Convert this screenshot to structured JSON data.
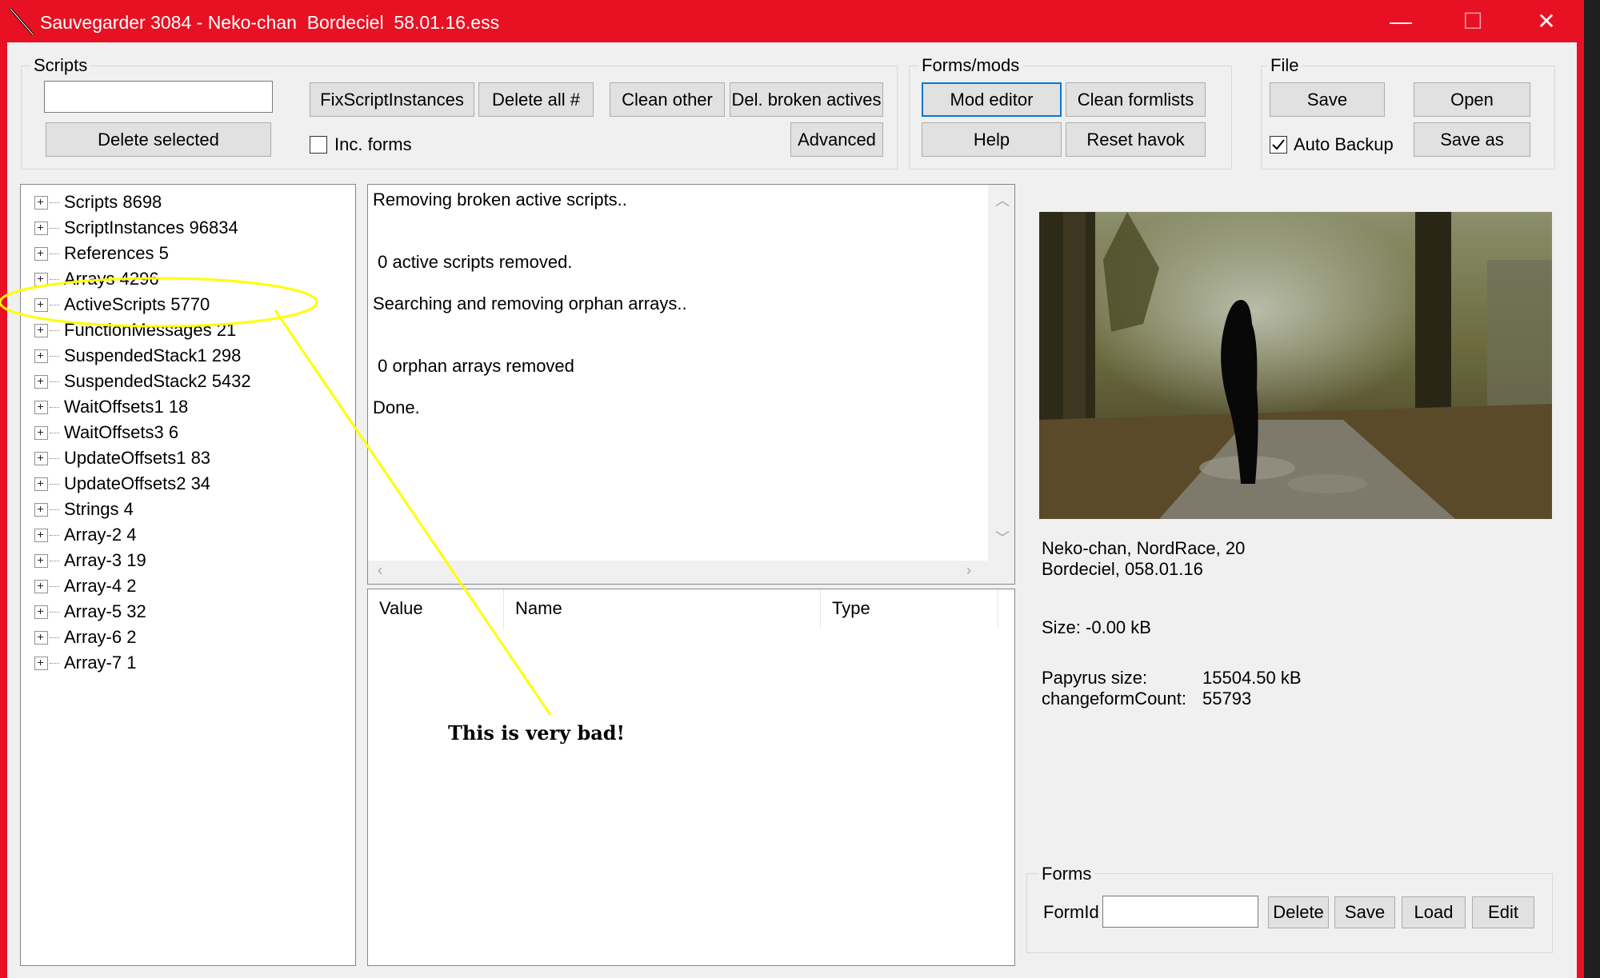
{
  "window": {
    "title": "Sauvegarder 3084 - Neko-chan  Bordeciel  58.01.16.ess",
    "minimize_glyph": "—",
    "maximize_glyph": "☐",
    "close_glyph": "✕",
    "accent": "#e81123"
  },
  "scripts_group": {
    "label": "Scripts",
    "search_value": "",
    "delete_selected": "Delete selected",
    "fix_script_instances": "FixScriptInstances",
    "delete_all": "Delete all #",
    "clean_other": "Clean other",
    "del_broken_actives": "Del. broken actives",
    "advanced": "Advanced",
    "inc_forms_label": "Inc. forms",
    "inc_forms_checked": false
  },
  "forms_mods_group": {
    "label": "Forms/mods",
    "mod_editor": "Mod editor",
    "clean_formlists": "Clean formlists",
    "help": "Help",
    "reset_havok": "Reset havok"
  },
  "file_group": {
    "label": "File",
    "save": "Save",
    "open": "Open",
    "auto_backup_label": "Auto Backup",
    "auto_backup_checked": true,
    "save_as": "Save as"
  },
  "tree": [
    {
      "label": "Scripts 8698"
    },
    {
      "label": "ScriptInstances 96834"
    },
    {
      "label": "References 5"
    },
    {
      "label": "Arrays 4296"
    },
    {
      "label": "ActiveScripts 5770"
    },
    {
      "label": "FunctionMessages 21"
    },
    {
      "label": "SuspendedStack1 298"
    },
    {
      "label": "SuspendedStack2 5432"
    },
    {
      "label": "WaitOffsets1 18"
    },
    {
      "label": "WaitOffsets3 6"
    },
    {
      "label": "UpdateOffsets1 83"
    },
    {
      "label": "UpdateOffsets2 34"
    },
    {
      "label": "Strings 4"
    },
    {
      "label": "Array-2 4"
    },
    {
      "label": "Array-3 19"
    },
    {
      "label": "Array-4 2"
    },
    {
      "label": "Array-5 32"
    },
    {
      "label": "Array-6 2"
    },
    {
      "label": "Array-7 1"
    }
  ],
  "log": [
    "Removing broken active scripts..",
    " 0 active scripts removed.",
    "Searching and removing orphan arrays..",
    " 0 orphan arrays removed",
    "Done."
  ],
  "table": {
    "columns": [
      "Value",
      "Name",
      "Type"
    ]
  },
  "annotation": {
    "text": "This is very bad!",
    "color": "#ffff00"
  },
  "save_info": {
    "character_line": "Neko-chan, NordRace, 20",
    "location_line": "Bordeciel, 058.01.16",
    "size_line": "Size: -0.00 kB",
    "papyrus_label": "Papyrus size:",
    "papyrus_value": "15504.50 kB",
    "changeform_label": "changeformCount:",
    "changeform_value": "55793"
  },
  "forms_group": {
    "label": "Forms",
    "formid_label": "FormId",
    "formid_value": "",
    "delete": "Delete",
    "save": "Save",
    "load": "Load",
    "edit": "Edit"
  }
}
